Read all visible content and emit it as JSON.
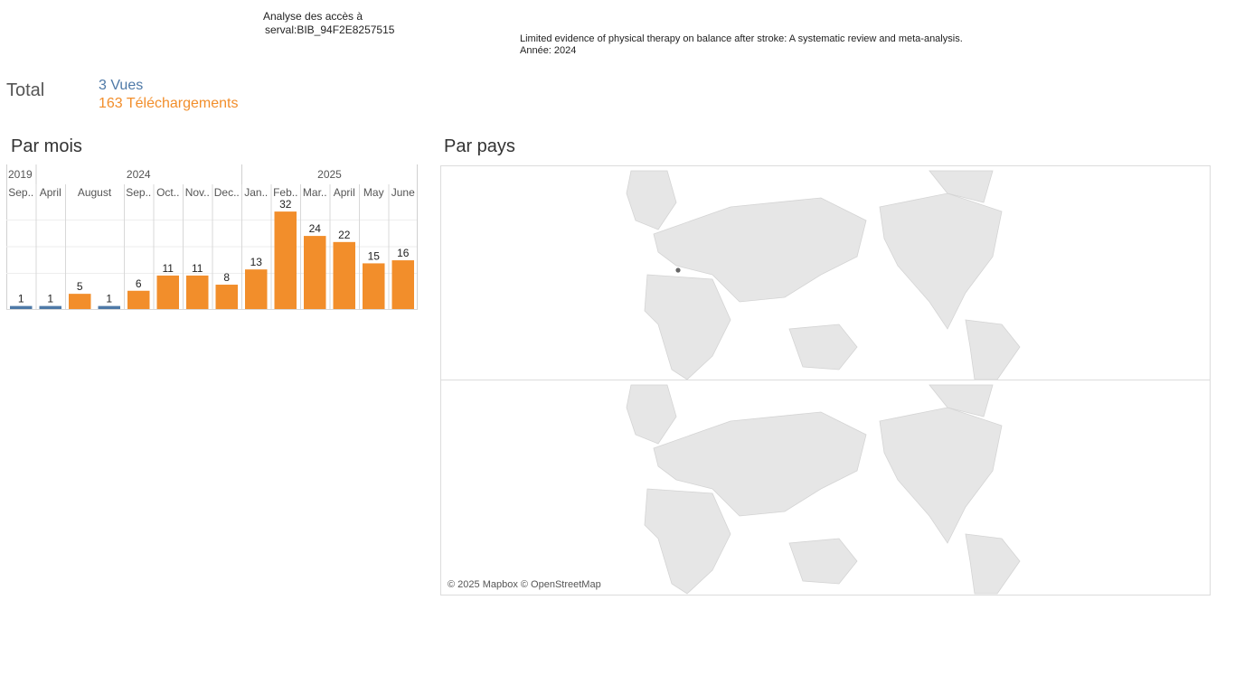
{
  "header": {
    "title_line1": "Analyse des accès à",
    "title_line2": "serval:BIB_94F2E8257515",
    "publication": "Limited evidence of physical therapy on balance after stroke: A systematic review and meta-analysis.",
    "year_label": "Année: 2024"
  },
  "totals": {
    "label": "Total",
    "views": "3 Vues",
    "downloads": "163 Téléchargements"
  },
  "colors": {
    "views": "#4e79a7",
    "downloads": "#f28e2b",
    "map_land": "#e6e6e6",
    "map_highlight": "#666666"
  },
  "sections": {
    "by_month": "Par mois",
    "by_country": "Par pays"
  },
  "chart_data": {
    "type": "bar",
    "years": [
      {
        "label": "2019",
        "span": [
          0,
          0
        ]
      },
      {
        "label": "2024",
        "span": [
          1,
          7
        ]
      },
      {
        "label": "2025",
        "span": [
          8,
          13
        ]
      }
    ],
    "categories": [
      "Sep..",
      "April",
      "August",
      "Sep..",
      "Oct..",
      "Nov..",
      "Dec..",
      "Jan..",
      "Feb..",
      "Mar..",
      "April",
      "May",
      "June"
    ],
    "category_slots": [
      1,
      1,
      2,
      1,
      1,
      1,
      1,
      1,
      1,
      1,
      1,
      1,
      1
    ],
    "values": [
      1,
      1,
      5,
      1,
      6,
      11,
      11,
      8,
      13,
      32,
      24,
      22,
      15,
      16
    ],
    "bar_months": [
      "Sep 2019",
      "April 2024",
      "August 2024",
      "August 2024",
      "Sep 2024",
      "Oct 2024",
      "Nov 2024",
      "Dec 2024",
      "Jan 2025",
      "Feb 2025",
      "Mar 2025",
      "April 2025",
      "May 2025",
      "June 2025"
    ],
    "bar_types": [
      "views",
      "views",
      "downloads",
      "views",
      "downloads",
      "downloads",
      "downloads",
      "downloads",
      "downloads",
      "downloads",
      "downloads",
      "downloads",
      "downloads",
      "downloads"
    ],
    "ylim": [
      0,
      35
    ],
    "grid": true
  },
  "map": {
    "attribution": "© 2025 Mapbox © OpenStreetMap",
    "highlighted_country": "Switzerland"
  }
}
